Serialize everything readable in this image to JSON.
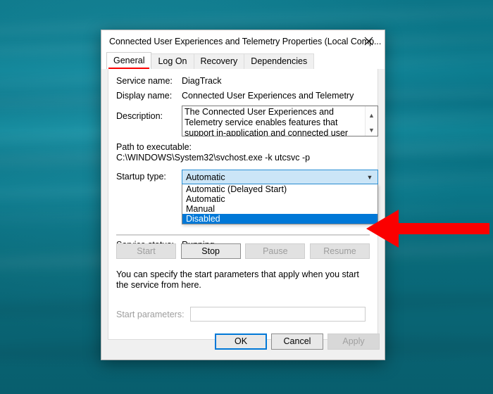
{
  "desktop": {
    "background_color": "#0b8094",
    "background_description": "teal water wallpaper"
  },
  "dialog": {
    "title": "Connected User Experiences and Telemetry Properties (Local Comp...",
    "close_icon": "close-icon",
    "tabs": [
      {
        "label": "General",
        "active": true,
        "annotated": true
      },
      {
        "label": "Log On",
        "active": false,
        "annotated": false
      },
      {
        "label": "Recovery",
        "active": false,
        "annotated": false
      },
      {
        "label": "Dependencies",
        "active": false,
        "annotated": false
      }
    ],
    "general": {
      "service_name_label": "Service name:",
      "service_name_value": "DiagTrack",
      "display_name_label": "Display name:",
      "display_name_value": "Connected User Experiences and Telemetry",
      "description_label": "Description:",
      "description_value": "The Connected User Experiences and Telemetry service enables features that support in-application and connected user experiences. Additionally, this",
      "scroll_up_icon": "chevron-up-icon",
      "scroll_down_icon": "chevron-down-icon",
      "path_label": "Path to executable:",
      "path_value": "C:\\WINDOWS\\System32\\svchost.exe -k utcsvc -p",
      "startup_type_label": "Startup type:",
      "startup_type_value": "Automatic",
      "startup_dropdown_icon": "chevron-down-icon",
      "startup_options": [
        {
          "label": "Automatic (Delayed Start)",
          "selected": false
        },
        {
          "label": "Automatic",
          "selected": false
        },
        {
          "label": "Manual",
          "selected": false
        },
        {
          "label": "Disabled",
          "selected": true
        }
      ],
      "service_status_label": "Service status:",
      "service_status_value": "Running",
      "action_buttons": [
        {
          "label": "Start",
          "enabled": false
        },
        {
          "label": "Stop",
          "enabled": true
        },
        {
          "label": "Pause",
          "enabled": false
        },
        {
          "label": "Resume",
          "enabled": false
        }
      ],
      "help_text": "You can specify the start parameters that apply when you start the service from here.",
      "start_parameters_label": "Start parameters:",
      "start_parameters_value": ""
    },
    "footer": {
      "ok_label": "OK",
      "cancel_label": "Cancel",
      "apply_label": "Apply",
      "apply_enabled": false
    }
  },
  "annotation": {
    "arrow_color": "#fb0000",
    "tab_underline_color": "#fb0000",
    "arrow_name": "red-pointer-arrow",
    "arrow_direction": "left",
    "arrow_target": "Disabled"
  }
}
